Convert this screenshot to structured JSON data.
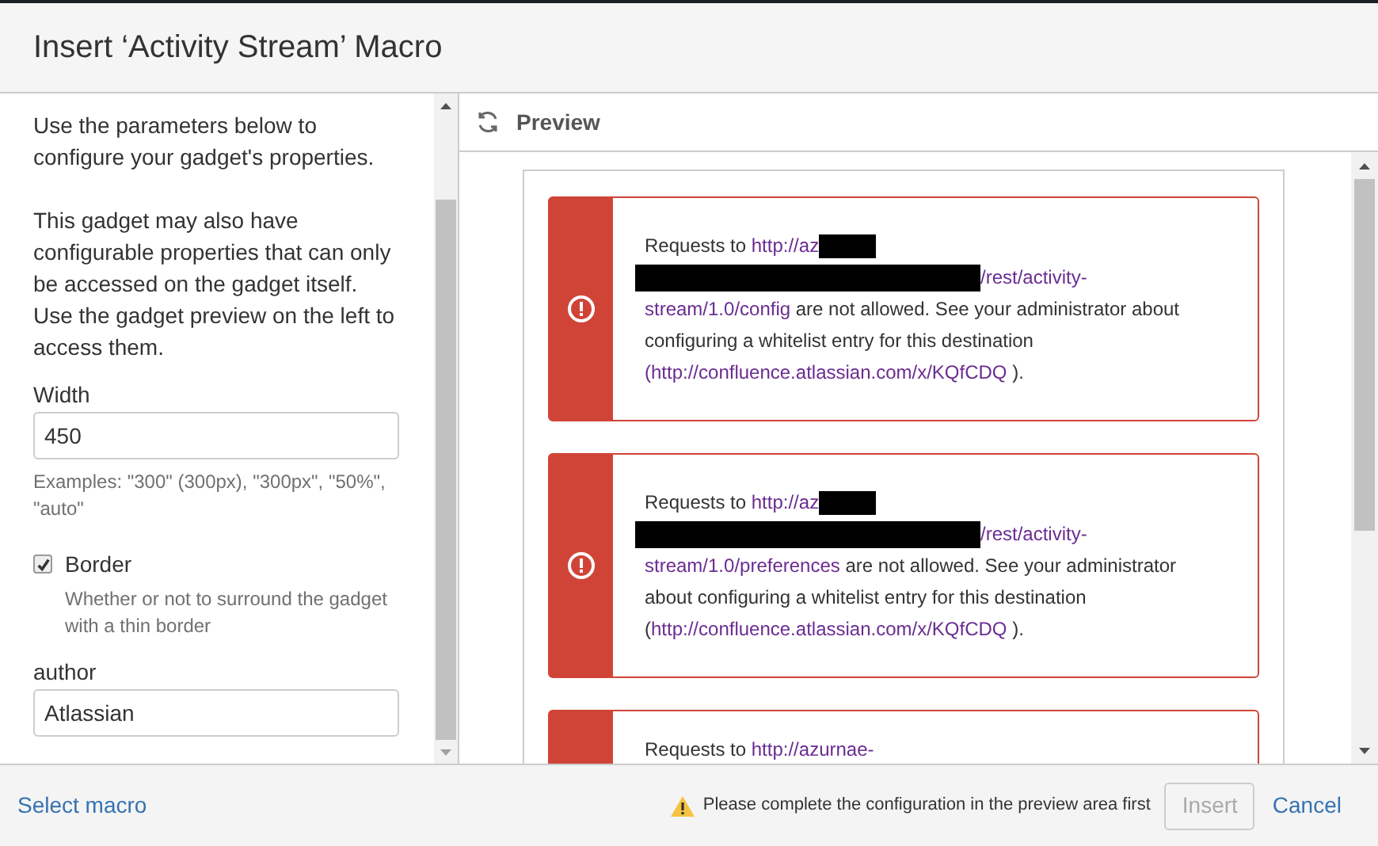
{
  "dialog": {
    "title": "Insert ‘Activity Stream’ Macro"
  },
  "sidebar": {
    "intro": "Use the parameters below to configure your gadget's properties.",
    "note": "This gadget may also have configurable properties that can only be accessed on the gadget itself. Use the gadget preview on the left to access them.",
    "fields": [
      {
        "kind": "text",
        "label": "Width",
        "value": "450",
        "help": "Examples: \"300\" (300px), \"300px\", \"50%\", \"auto\""
      },
      {
        "kind": "checkbox",
        "label": "Border",
        "checked": true,
        "help": "Whether or not to surround the gadget with a thin border"
      },
      {
        "kind": "text",
        "label": "author",
        "value": "Atlassian"
      }
    ]
  },
  "preview": {
    "title": "Preview",
    "alerts": [
      {
        "segments": [
          {
            "kind": "text",
            "text": "Requests to "
          },
          {
            "kind": "link",
            "text": "http://az"
          },
          {
            "kind": "redaction"
          },
          {
            "kind": "redaction"
          },
          {
            "kind": "link",
            "text": "/rest/activity-"
          },
          {
            "kind": "link",
            "text": "stream/1.0/config"
          },
          {
            "kind": "text",
            "text": " are not allowed. See your administrator about configuring a whitelist entry for this destination "
          },
          {
            "kind": "link",
            "text": "(http://confluence.atlassian.com/x/KQfCDQ"
          },
          {
            "kind": "text",
            "text": " )."
          }
        ]
      },
      {
        "segments": [
          {
            "kind": "text",
            "text": "Requests to "
          },
          {
            "kind": "link",
            "text": "http://az"
          },
          {
            "kind": "redaction"
          },
          {
            "kind": "redaction"
          },
          {
            "kind": "link",
            "text": "/rest/activity-"
          },
          {
            "kind": "link",
            "text": "stream/1.0/preferences"
          },
          {
            "kind": "text",
            "text": " are not allowed. See your administrator about configuring a whitelist entry for this destination ("
          },
          {
            "kind": "link",
            "text": "http://confluence.atlassian.com/x/KQfCDQ"
          },
          {
            "kind": "text",
            "text": " )."
          }
        ]
      },
      {
        "segments": [
          {
            "kind": "text",
            "text": "Requests to "
          },
          {
            "kind": "link",
            "text": "http://azurnae-"
          }
        ]
      }
    ]
  },
  "footer": {
    "select_link": "Select macro",
    "warning": "Please complete the configuration in the preview area first",
    "insert": {
      "label": "Insert",
      "disabled": true
    },
    "cancel": "Cancel"
  }
}
